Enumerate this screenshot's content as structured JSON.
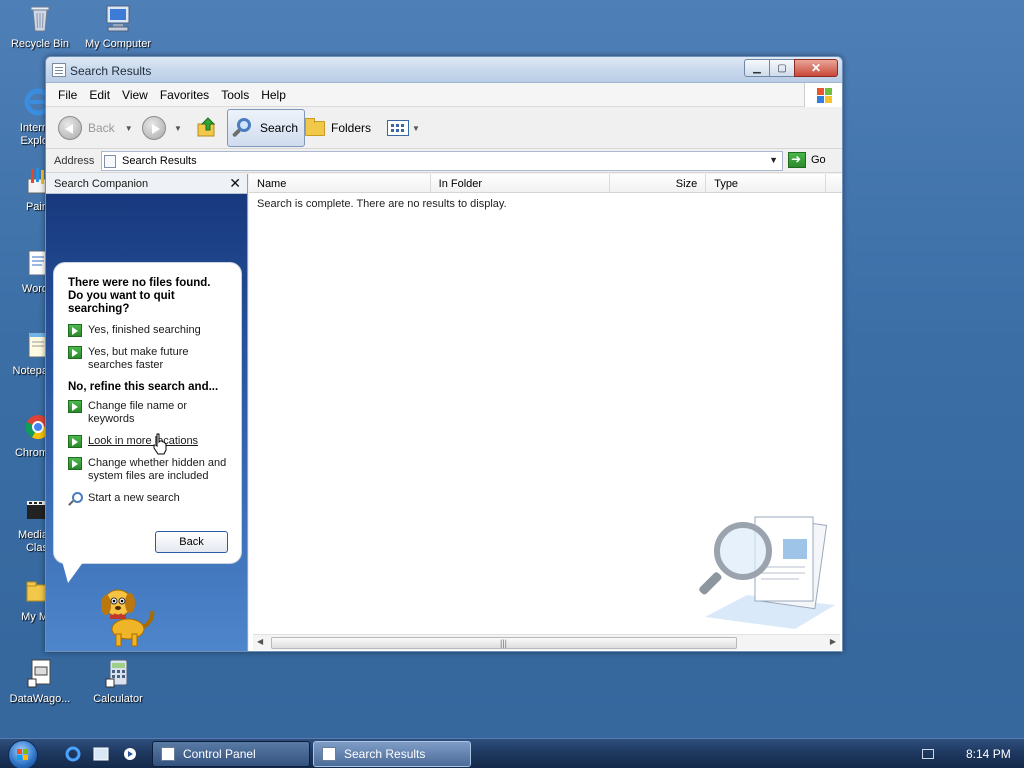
{
  "desktop": {
    "icons": [
      {
        "label": "Recycle Bin",
        "icon": "recycle-bin-icon"
      },
      {
        "label": "My Computer",
        "icon": "my-computer-icon"
      },
      {
        "label": "Intern Explo",
        "icon": "internet-explorer-icon"
      },
      {
        "label": "Pain",
        "icon": "paint-icon"
      },
      {
        "label": "Word",
        "icon": "wordpad-icon"
      },
      {
        "label": "Notepa",
        "icon": "notepad-icon"
      },
      {
        "label": "Chrom",
        "icon": "chrome-icon"
      },
      {
        "label": "Media Clas",
        "icon": "media-player-classic-icon"
      },
      {
        "label": "My M",
        "icon": "my-music-icon"
      },
      {
        "label": "DataWago...",
        "icon": "datawagon-icon"
      },
      {
        "label": "Calculator",
        "icon": "calculator-icon"
      }
    ]
  },
  "window": {
    "title": "Search Results",
    "controls": {
      "minimize": "minimize",
      "maximize": "maximize",
      "close": "close"
    }
  },
  "menubar": {
    "items": [
      "File",
      "Edit",
      "View",
      "Favorites",
      "Tools",
      "Help"
    ]
  },
  "toolbar": {
    "back_label": "Back",
    "search_label": "Search",
    "folders_label": "Folders"
  },
  "address": {
    "label": "Address",
    "value": "Search Results",
    "go_label": "Go"
  },
  "companion": {
    "title": "Search Companion",
    "heading": "There were no files found. Do you want to quit searching?",
    "quit_options": [
      "Yes, finished searching",
      "Yes, but make future searches faster"
    ],
    "refine_heading": "No, refine this search and...",
    "refine_options": [
      "Change file name or keywords",
      "Look in more locations",
      "Change whether hidden and system files are included"
    ],
    "new_search": "Start a new search",
    "back_button": "Back"
  },
  "results": {
    "columns": [
      "Name",
      "In Folder",
      "Size",
      "Type"
    ],
    "message": "Search is complete. There are no results to display."
  },
  "taskbar": {
    "tasks": [
      "Control Panel",
      "Search Results"
    ],
    "active_task": "Search Results",
    "clock": "8:14 PM"
  },
  "colors": {
    "desktop": "#3a6ea5",
    "companion_gradient_top": "#16357a",
    "accent_green": "#2c8a2c"
  }
}
